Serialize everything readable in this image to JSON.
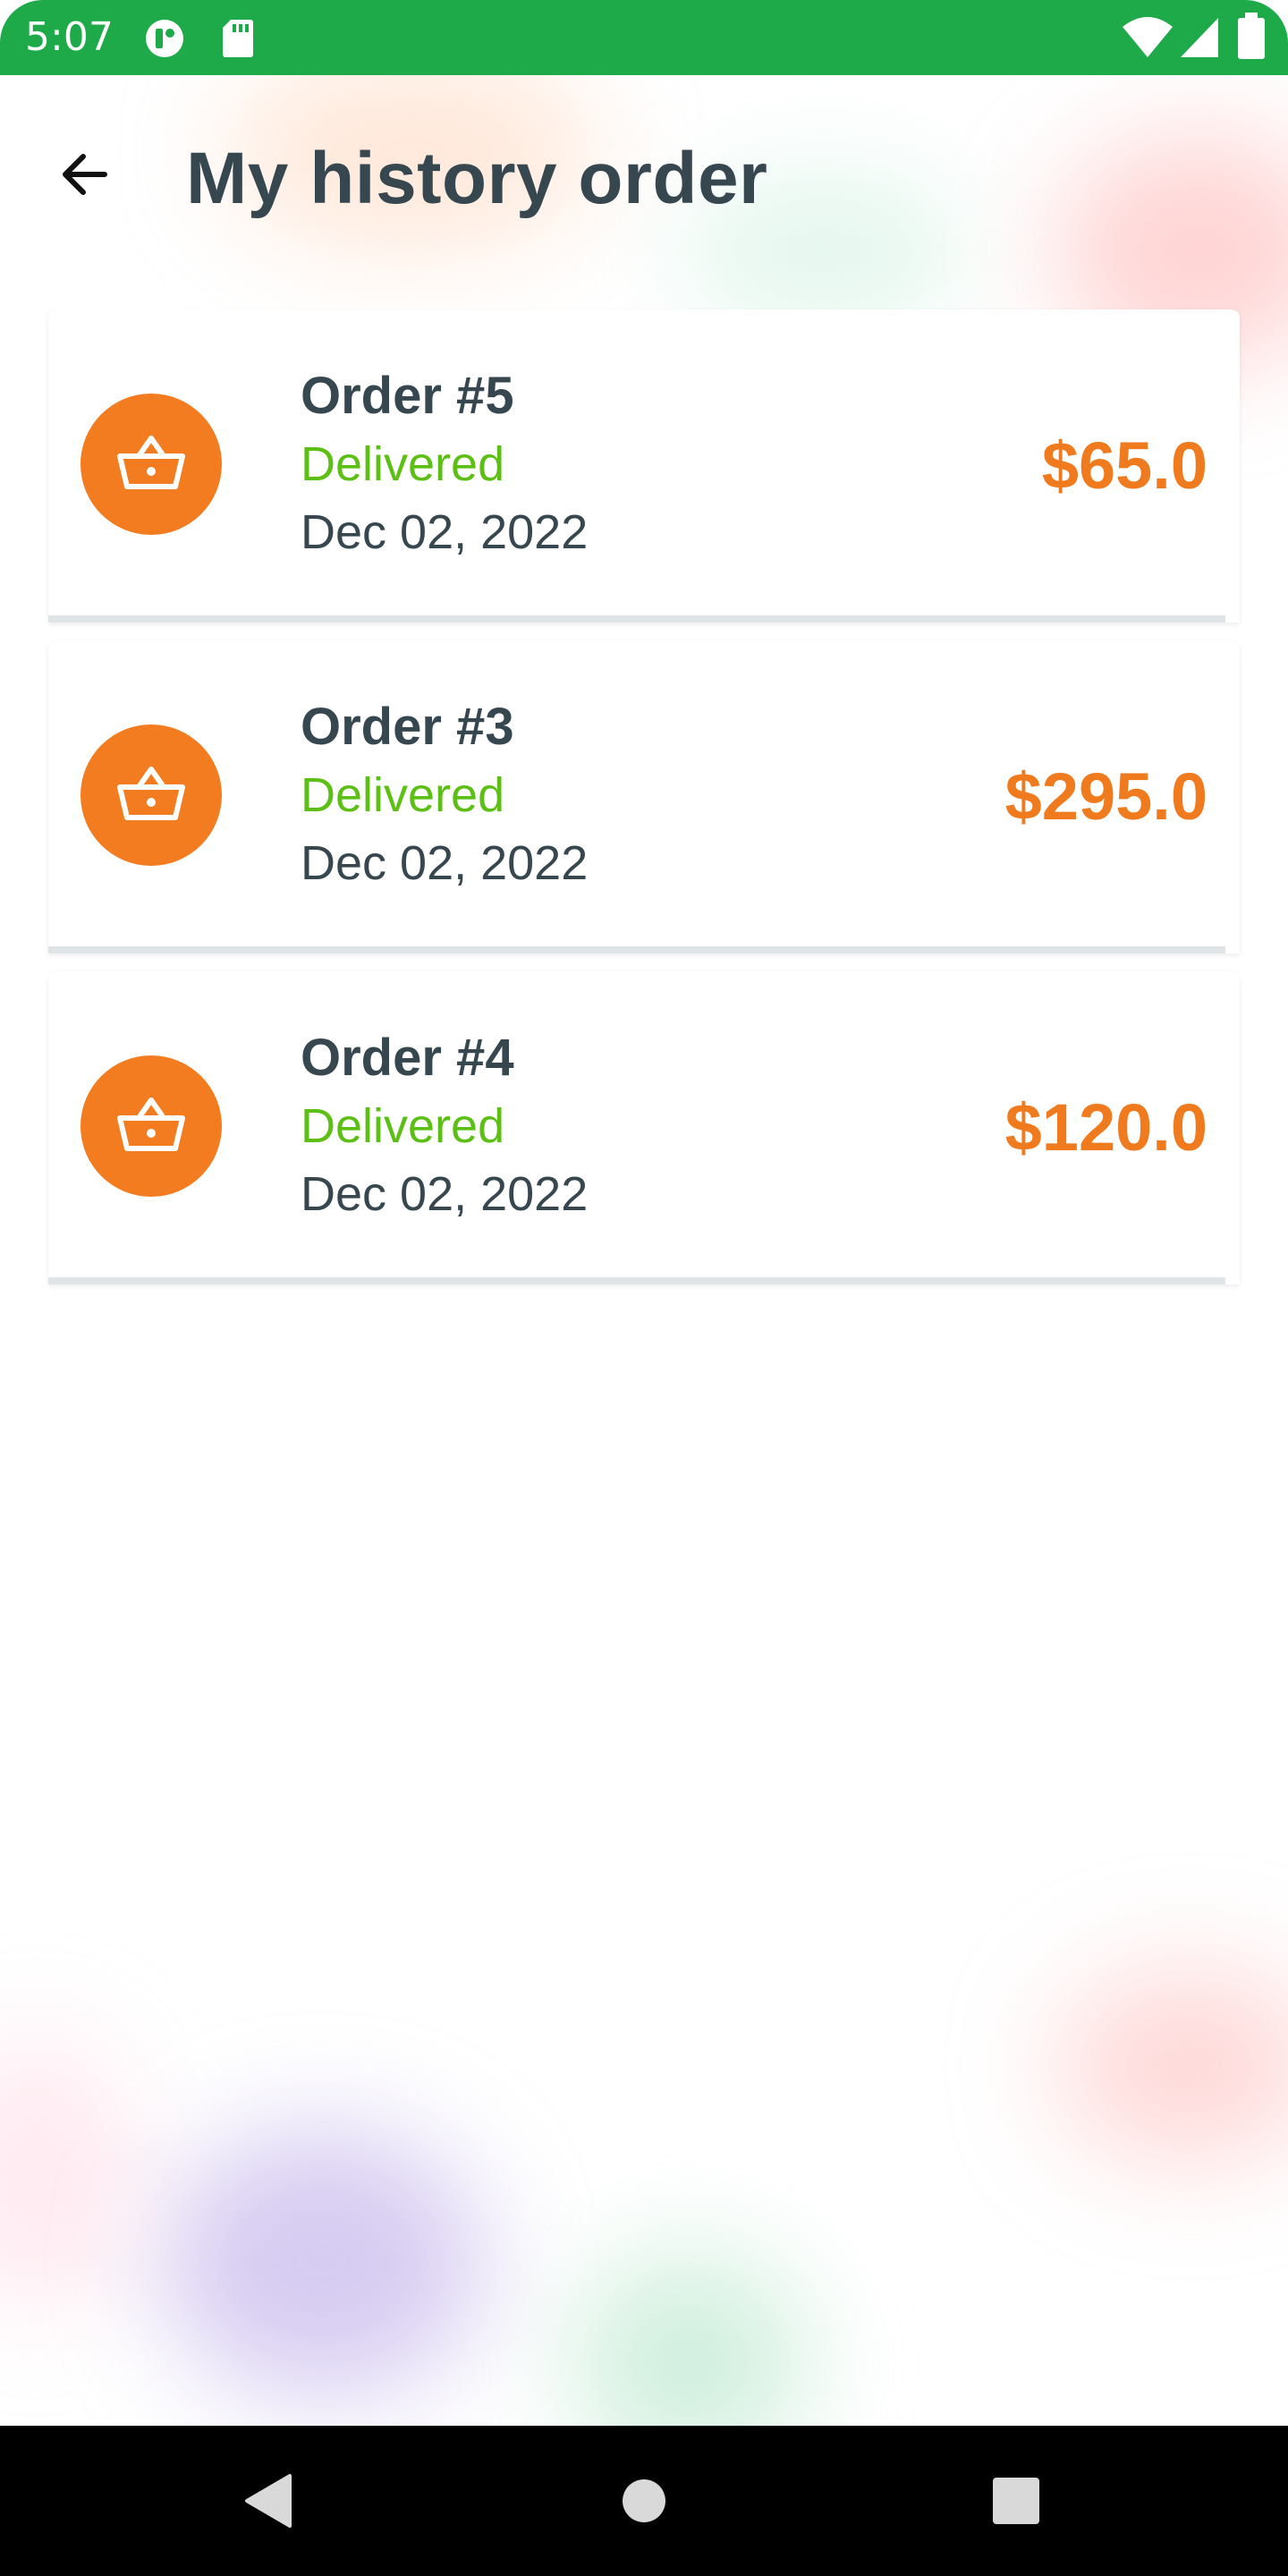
{
  "status_bar": {
    "time": "5:07",
    "icons": [
      "notification-icon",
      "sd-card-icon",
      "wifi-icon",
      "signal-icon",
      "battery-icon"
    ]
  },
  "header": {
    "title": "My history order",
    "back_icon": "arrow-left-icon"
  },
  "orders": [
    {
      "name": "Order #5",
      "status": "Delivered",
      "date": "Dec 02, 2022",
      "total": "$65.0",
      "icon": "basket-icon"
    },
    {
      "name": "Order #3",
      "status": "Delivered",
      "date": "Dec 02, 2022",
      "total": "$295.0",
      "icon": "basket-icon"
    },
    {
      "name": "Order #4",
      "status": "Delivered",
      "date": "Dec 02, 2022",
      "total": "$120.0",
      "icon": "basket-icon"
    }
  ],
  "colors": {
    "status_bar": "#1faa4a",
    "title": "#37474f",
    "icon_bg": "#f47c20",
    "status_delivered": "#5bbf14",
    "price": "#f07a1e",
    "divider": "#dfe4e6"
  },
  "nav_bar": {
    "buttons": [
      "back-triangle-icon",
      "home-circle-icon",
      "recents-square-icon"
    ]
  }
}
